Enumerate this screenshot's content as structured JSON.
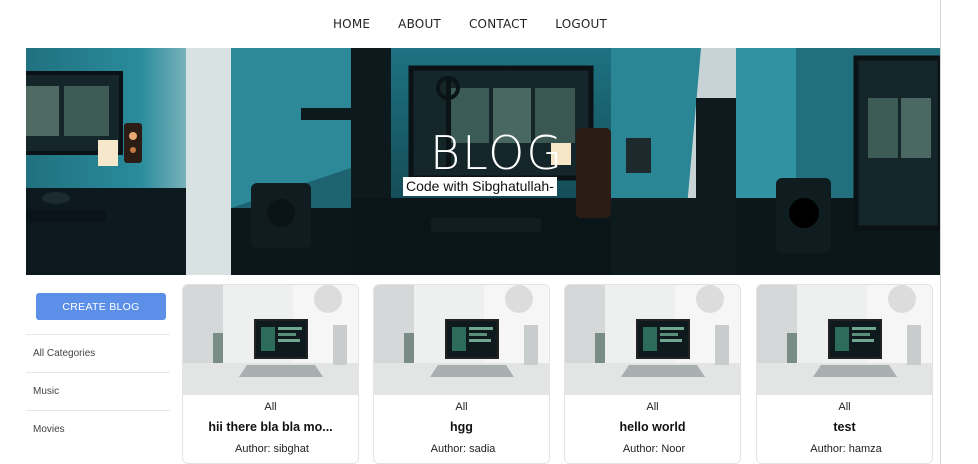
{
  "nav": {
    "items": [
      {
        "label": "HOME"
      },
      {
        "label": "ABOUT"
      },
      {
        "label": "CONTACT"
      },
      {
        "label": "LOGOUT"
      }
    ]
  },
  "banner": {
    "title": "BLOG",
    "subtitle": "Code with Sibghatullah-"
  },
  "sidebar": {
    "create_label": "CREATE BLOG",
    "categories": [
      {
        "label": "All Categories"
      },
      {
        "label": "Music"
      },
      {
        "label": "Movies"
      }
    ]
  },
  "posts": [
    {
      "category": "All",
      "title": "hii there bla bla mo...",
      "author_prefix": "Author:",
      "author": "sibghat"
    },
    {
      "category": "All",
      "title": "hgg",
      "author_prefix": "Author:",
      "author": "sadia"
    },
    {
      "category": "All",
      "title": "hello world",
      "author_prefix": "Author:",
      "author": "Noor"
    },
    {
      "category": "All",
      "title": "test",
      "author_prefix": "Author:",
      "author": "hamza"
    }
  ],
  "colors": {
    "accent": "#5b8fe8"
  }
}
